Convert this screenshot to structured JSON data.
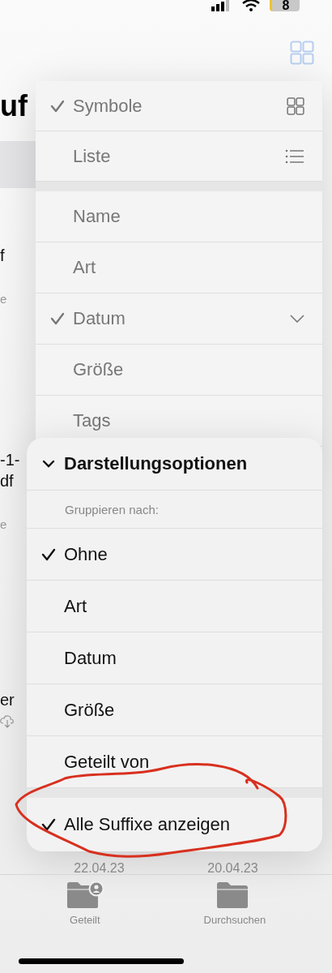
{
  "status_bar": {
    "battery": "8"
  },
  "header": {
    "title": "uf"
  },
  "background_fragments": [
    {
      "text": "f",
      "kind": "name"
    },
    {
      "text": "e",
      "kind": "meta"
    },
    {
      "text": "-1-",
      "kind": "name"
    },
    {
      "text": "df",
      "kind": "name"
    },
    {
      "text": "e",
      "kind": "meta"
    },
    {
      "text": "er",
      "kind": "name"
    }
  ],
  "dates": [
    "22.04.23",
    "20.04.23"
  ],
  "view_menu": {
    "layout_items": [
      {
        "label": "Symbole",
        "selected": true
      },
      {
        "label": "Liste",
        "selected": false
      }
    ],
    "sort_items": [
      {
        "label": "Name",
        "selected": false
      },
      {
        "label": "Art",
        "selected": false
      },
      {
        "label": "Datum",
        "selected": true
      },
      {
        "label": "Größe",
        "selected": false
      },
      {
        "label": "Tags",
        "selected": false
      }
    ]
  },
  "options_menu": {
    "title": "Darstellungsoptionen",
    "expanded": true,
    "group_label": "Gruppieren nach:",
    "group_items": [
      {
        "label": "Ohne",
        "selected": true
      },
      {
        "label": "Art",
        "selected": false
      },
      {
        "label": "Datum",
        "selected": false
      },
      {
        "label": "Größe",
        "selected": false
      },
      {
        "label": "Geteilt von",
        "selected": false
      }
    ],
    "suffix_toggle": {
      "label": "Alle Suffixe anzeigen",
      "checked": true
    }
  },
  "tab_bar": [
    {
      "label": "Geteilt",
      "selected": false
    },
    {
      "label": "Durchsuchen",
      "selected": false
    }
  ]
}
